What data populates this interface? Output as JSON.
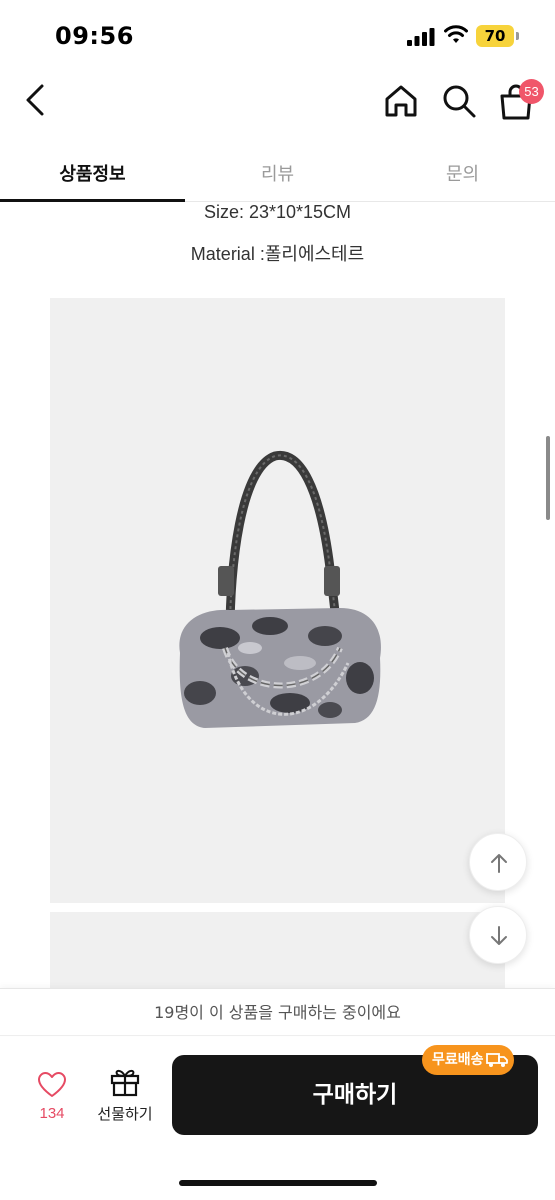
{
  "status_bar": {
    "time": "09:56",
    "battery": "70"
  },
  "header": {
    "back_icon": "chevron-left-icon",
    "home_icon": "home-icon",
    "search_icon": "search-icon",
    "cart_icon": "shopping-bag-icon",
    "cart_count": "53"
  },
  "tabs": [
    {
      "label": "상품정보",
      "active": true
    },
    {
      "label": "리뷰",
      "active": false
    },
    {
      "label": "문의",
      "active": false
    }
  ],
  "product_info": {
    "size_text": "Size: 23*10*15CM",
    "material_text": "Material :폴리에스테르"
  },
  "floating": {
    "up_icon": "arrow-up-icon",
    "down_icon": "arrow-down-icon"
  },
  "buying_banner": "19명이 이 상품을 구매하는 중이에요",
  "bottom_bar": {
    "like_count": "134",
    "gift_label": "선물하기",
    "buy_label": "구매하기",
    "free_shipping_badge": "무료배송"
  },
  "colors": {
    "badge_red": "#f0566a",
    "like_pink": "#e64a63",
    "buy_button": "#161616",
    "shipping_orange": "#f7941d",
    "battery_yellow": "#f7d33b"
  }
}
